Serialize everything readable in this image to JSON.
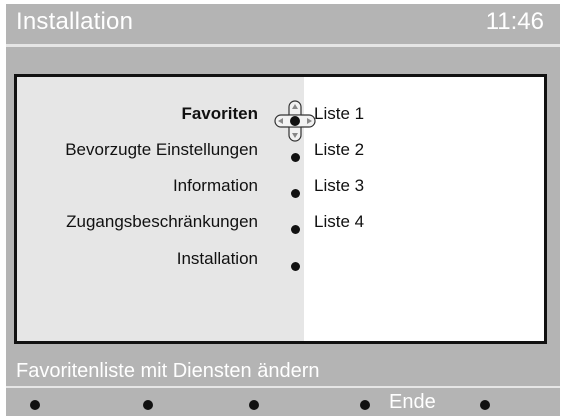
{
  "header": {
    "title": "Installation",
    "time": "11:46"
  },
  "menu": {
    "items": [
      {
        "label": "Favoriten",
        "selected": true
      },
      {
        "label": "Bevorzugte Einstellungen",
        "selected": false
      },
      {
        "label": "Information",
        "selected": false
      },
      {
        "label": "Zugangsbeschränkungen",
        "selected": false
      },
      {
        "label": "Installation",
        "selected": false
      }
    ],
    "submenu": [
      "Liste 1",
      "Liste 2",
      "Liste 3",
      "Liste 4"
    ]
  },
  "status": {
    "text": "Favoritenliste mit Diensten ändern"
  },
  "function_keys": {
    "key4_label": "Ende"
  },
  "colors": {
    "background": "#b4b4b4",
    "panel_left": "#e6e6e6",
    "panel_right": "#ffffff",
    "text_light": "#ffffff",
    "text_dark": "#111111"
  }
}
